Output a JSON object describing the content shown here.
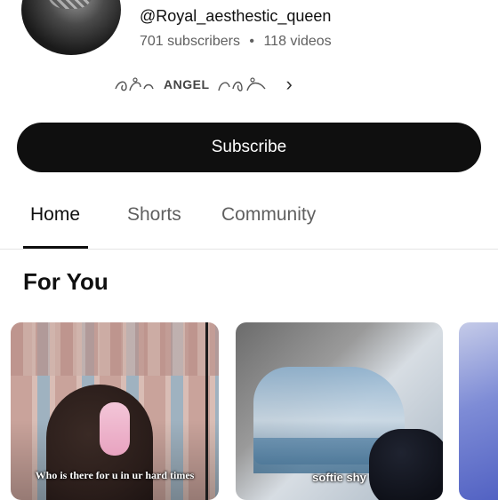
{
  "channel": {
    "handle": "@Royal_aesthestic_queen",
    "subscribers": "701 subscribers",
    "separator": "•",
    "videos": "118 videos",
    "link_text": "ANGEL"
  },
  "actions": {
    "subscribe_label": "Subscribe"
  },
  "tabs": [
    {
      "label": "Home",
      "active": true
    },
    {
      "label": "Shorts",
      "active": false
    },
    {
      "label": "Community",
      "active": false
    }
  ],
  "section": {
    "title": "For You"
  },
  "videos": [
    {
      "caption": "Who is there for u in ur hard times"
    },
    {
      "caption": "softie shy"
    },
    {
      "caption": ""
    }
  ],
  "icons": {
    "chevron": "chevron-right-icon"
  },
  "colors": {
    "primary_button": "#0f0f0f",
    "secondary_text": "#606060"
  }
}
